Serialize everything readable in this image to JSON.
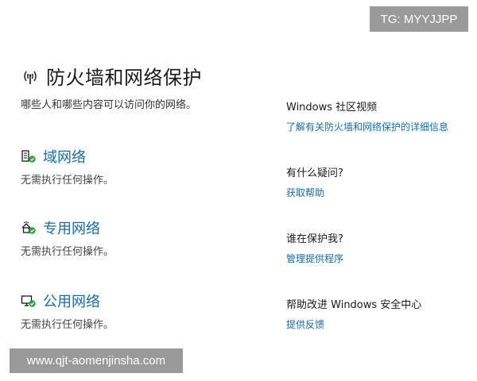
{
  "watermarks": {
    "top_right": "TG: MYYJJPP",
    "bottom_left": "www.qjt-aomenjinsha.com"
  },
  "header": {
    "icon": "firewall-antenna-icon",
    "title": "防火墙和网络保护",
    "description": "哪些人和哪些内容可以访问你的网络。"
  },
  "networks": [
    {
      "icon": "domain-network-icon",
      "name": "域网络",
      "status": "无需执行任何操作。"
    },
    {
      "icon": "private-network-icon",
      "name": "专用网络",
      "status": "无需执行任何操作。"
    },
    {
      "icon": "public-network-icon",
      "name": "公用网络",
      "status": "无需执行任何操作。"
    }
  ],
  "sidebar": [
    {
      "heading": "Windows 社区视频",
      "link": "了解有关防火墙和网络保护的详细信息"
    },
    {
      "heading": "有什么疑问?",
      "link": "获取帮助"
    },
    {
      "heading": "谁在保护我?",
      "link": "管理提供程序"
    },
    {
      "heading": "帮助改进 Windows 安全中心",
      "link": "提供反馈"
    }
  ],
  "colors": {
    "link": "#1b6aa5",
    "ok_green": "#2e9e3e",
    "watermark_bg": "#9a9a9a"
  }
}
